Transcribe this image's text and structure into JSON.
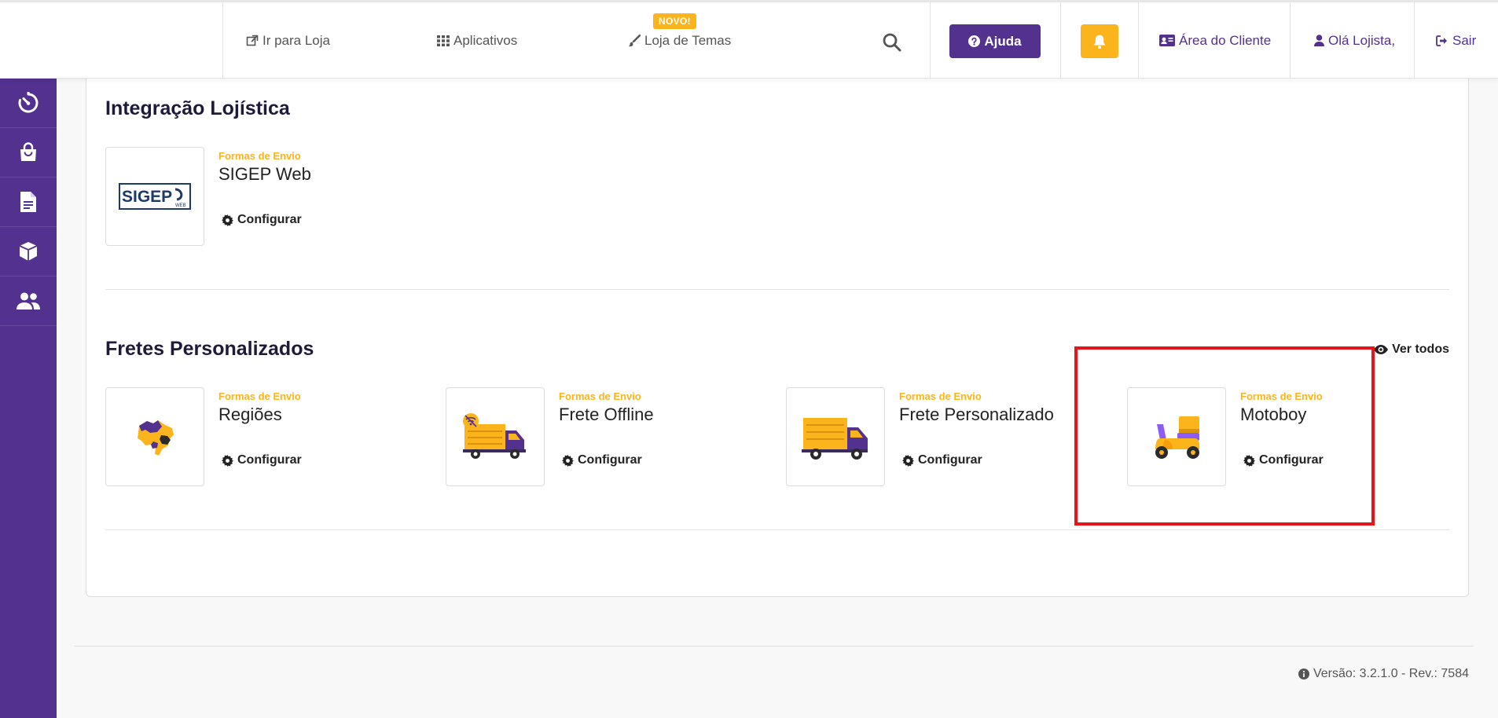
{
  "header": {
    "nav": {
      "store_link": "Ir para Loja",
      "apps": "Aplicativos",
      "themes": "Loja de Temas",
      "new_badge": "NOVO!"
    },
    "help": "Ajuda",
    "client_area": "Área do Cliente",
    "greeting": "Olá Lojista,",
    "logout": "Sair"
  },
  "sidebar": {
    "items": [
      {
        "icon": "dashboard-icon"
      },
      {
        "icon": "shopping-bag-icon"
      },
      {
        "icon": "document-icon"
      },
      {
        "icon": "box-icon"
      },
      {
        "icon": "users-icon"
      }
    ]
  },
  "sections": {
    "logistics": {
      "title": "Integração Lojística",
      "plugins": [
        {
          "category": "Formas de Envio",
          "name": "SIGEP Web",
          "action": "Configurar",
          "logo_text": "SIGEP",
          "logo_sub": "WEB"
        }
      ]
    },
    "custom": {
      "title": "Fretes Personalizados",
      "see_all": "Ver todos",
      "plugins": [
        {
          "category": "Formas de Envio",
          "name": "Regiões",
          "action": "Configurar"
        },
        {
          "category": "Formas de Envio",
          "name": "Frete Offline",
          "action": "Configurar"
        },
        {
          "category": "Formas de Envio",
          "name": "Frete Personalizado",
          "action": "Configurar"
        },
        {
          "category": "Formas de Envio",
          "name": "Motoboy",
          "action": "Configurar"
        }
      ]
    }
  },
  "footer": {
    "version": "Versão: 3.2.1.0 - Rev.: 7584"
  },
  "colors": {
    "brand_purple": "#53318f",
    "accent_yellow": "#fbb41b",
    "highlight_red": "#e8141c"
  }
}
